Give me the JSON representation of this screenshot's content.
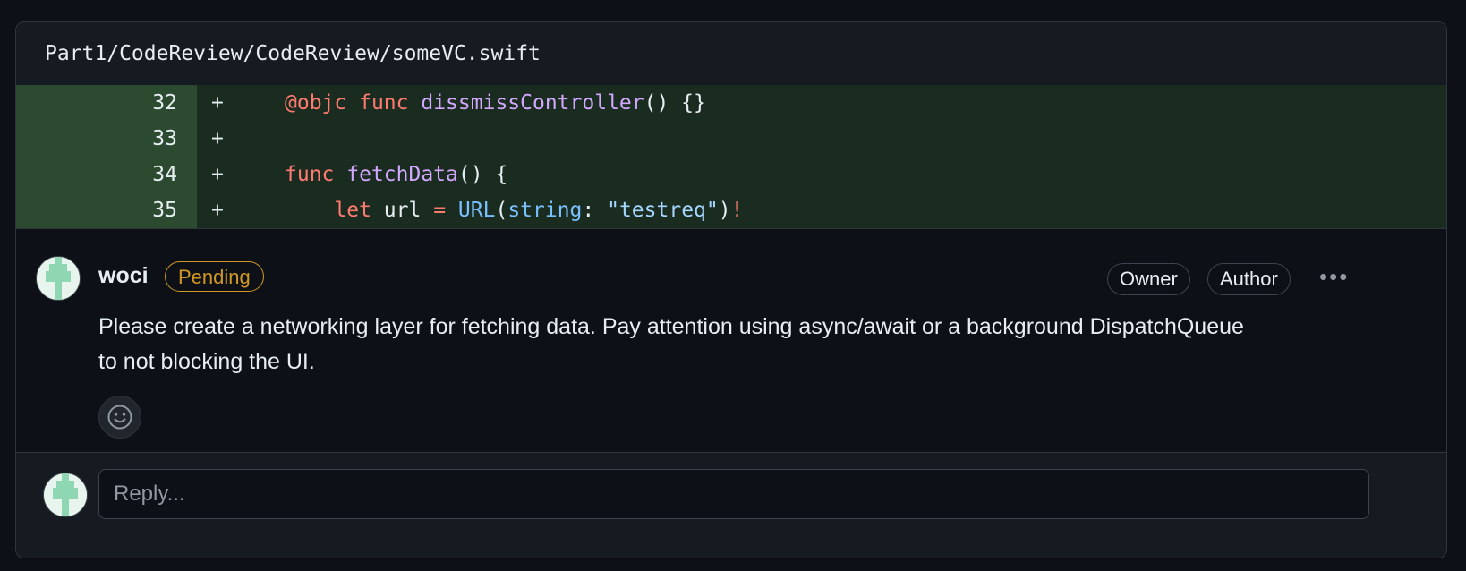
{
  "file": {
    "path": "Part1/CodeReview/CodeReview/someVC.swift"
  },
  "diff": {
    "lines": [
      {
        "number": "32",
        "sign": "+",
        "code": "    @objc func dissmissController() {}"
      },
      {
        "number": "33",
        "sign": "+",
        "code": ""
      },
      {
        "number": "34",
        "sign": "+",
        "code": "    func fetchData() {"
      },
      {
        "number": "35",
        "sign": "+",
        "code": "        let url = URL(string: \"testreq\")!"
      }
    ]
  },
  "comment": {
    "author": "woci",
    "status_badge": "Pending",
    "roles": [
      "Owner",
      "Author"
    ],
    "more_label": "•••",
    "text": "Please create a networking layer for fetching data. Pay attention using async/await or a background DispatchQueue to not blocking the UI.",
    "reaction_icon": "smiley-icon"
  },
  "reply": {
    "placeholder": "Reply..."
  },
  "colors": {
    "added_line_bg": "#1a2b1f",
    "added_gutter_bg": "#2b4a2f",
    "pending": "#d29922"
  }
}
